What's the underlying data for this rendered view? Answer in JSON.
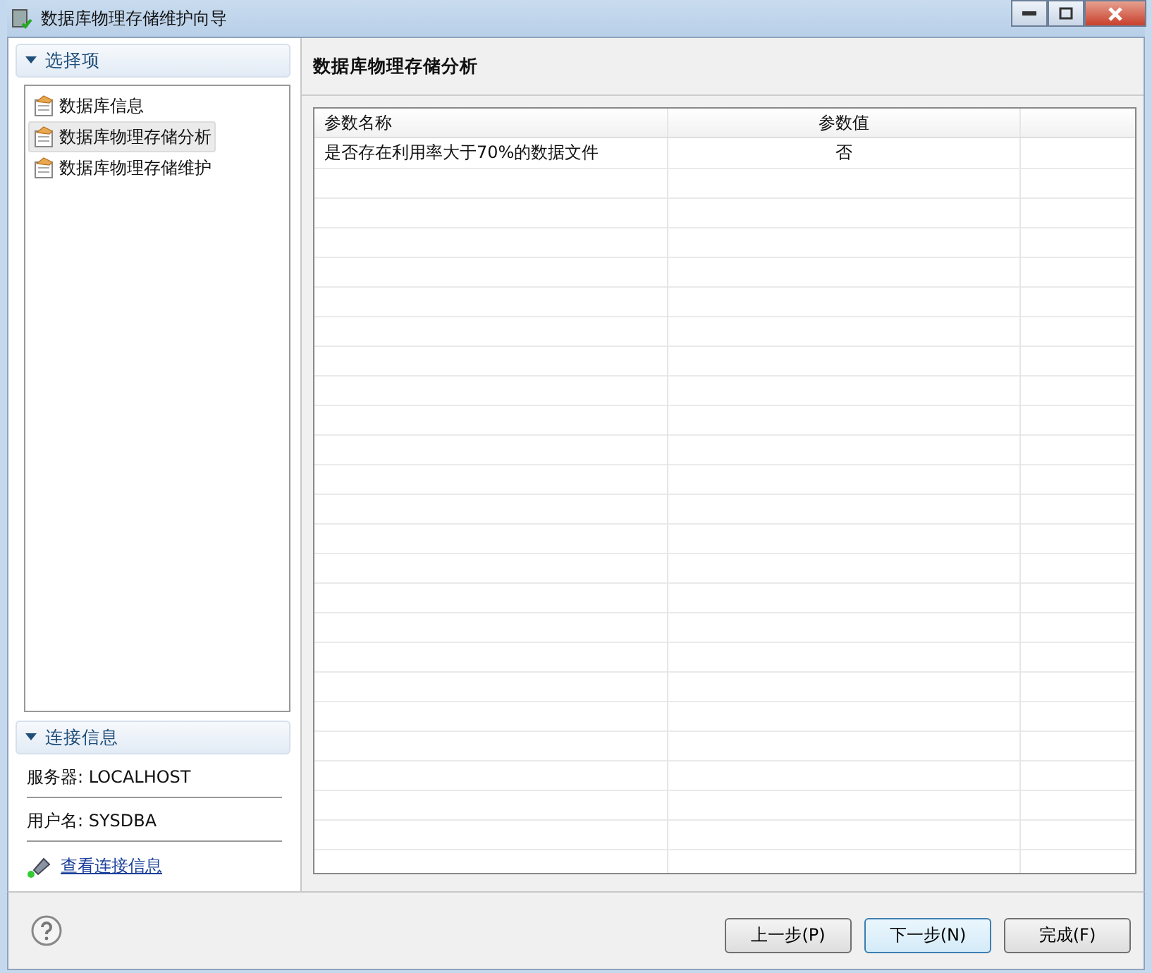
{
  "window": {
    "title": "数据库物理存储维护向导"
  },
  "options_section": {
    "title": "选择项",
    "expanded": true,
    "items": [
      {
        "label": "数据库信息",
        "selected": false
      },
      {
        "label": "数据库物理存储分析",
        "selected": true
      },
      {
        "label": "数据库物理存储维护",
        "selected": false
      }
    ]
  },
  "connection_section": {
    "title": "连接信息",
    "expanded": true,
    "server": "服务器: LOCALHOST",
    "user": "用户名: SYSDBA",
    "link": "查看连接信息"
  },
  "page": {
    "title": "数据库物理存储分析"
  },
  "table": {
    "columns": [
      "参数名称",
      "参数值"
    ],
    "rows": [
      {
        "cells": [
          "是否存在利用率大于70%的数据文件",
          "否"
        ]
      }
    ]
  },
  "buttons": [
    {
      "label": "上一步(P)",
      "default": false
    },
    {
      "label": "下一步(N)",
      "default": true
    },
    {
      "label": "完成(F)",
      "default": false
    }
  ]
}
